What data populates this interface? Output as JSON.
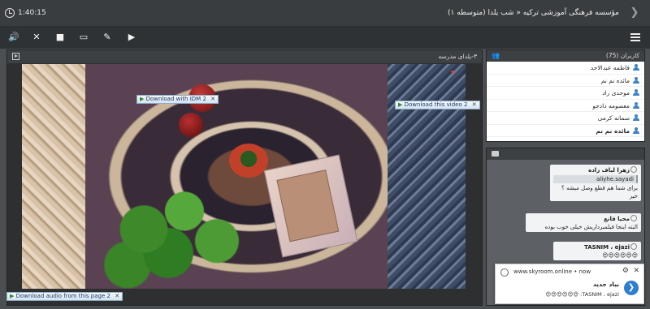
{
  "header": {
    "timer": "1:40:15",
    "title": "مؤسسه فرهنگی آموزشی ترکیه « شب یلدا (متوسطه ۱)"
  },
  "icons": {
    "clock": "clock-icon",
    "speaker": "speaker-icon",
    "mic": "mic-muted-icon",
    "camera": "video-camera-icon",
    "screen": "screen-share-icon",
    "brush": "whiteboard-brush-icon",
    "media": "media-play-icon",
    "menu": "hamburger-menu-icon",
    "people": "people-icon",
    "chat": "chat-icon",
    "user": "user-icon"
  },
  "video": {
    "title": "۳-یلدای مدرسه",
    "idm_download": "Download with IDM",
    "idm_download_video": "Download this video",
    "idm_download_audio": "Download audio from this page",
    "idm_count": "2"
  },
  "users": {
    "title": "کاربران (75)",
    "list": [
      {
        "name": "فاطمه عبدالاحد",
        "bold": false
      },
      {
        "name": "مائده نم نم",
        "bold": false
      },
      {
        "name": "موحدی راد",
        "bold": false
      },
      {
        "name": "معصومه دادجو",
        "bold": false
      },
      {
        "name": "سمانه کرمی",
        "bold": false
      },
      {
        "name": "مائده نم نم",
        "bold": true
      }
    ]
  },
  "chat": {
    "messages": [
      {
        "who": "زهرا لباف زاده",
        "quote": "aliyhe.sayadi",
        "text": "برای شما هم قطع وصل میشه ؟",
        "extra": "خیر"
      },
      {
        "who": "محیا قانع",
        "text": "البته اینجا فیلمبرداریش خیلی خوب بوده"
      },
      {
        "who": "TASNIM ، ejazi",
        "text": "😍😍😍😍😍😍"
      }
    ]
  },
  "notification": {
    "site": "www.skyroom.online • now",
    "title": "بیاد جدید",
    "body": "TASNIM ، ejazi: 😍😍😍😍😍😍"
  }
}
